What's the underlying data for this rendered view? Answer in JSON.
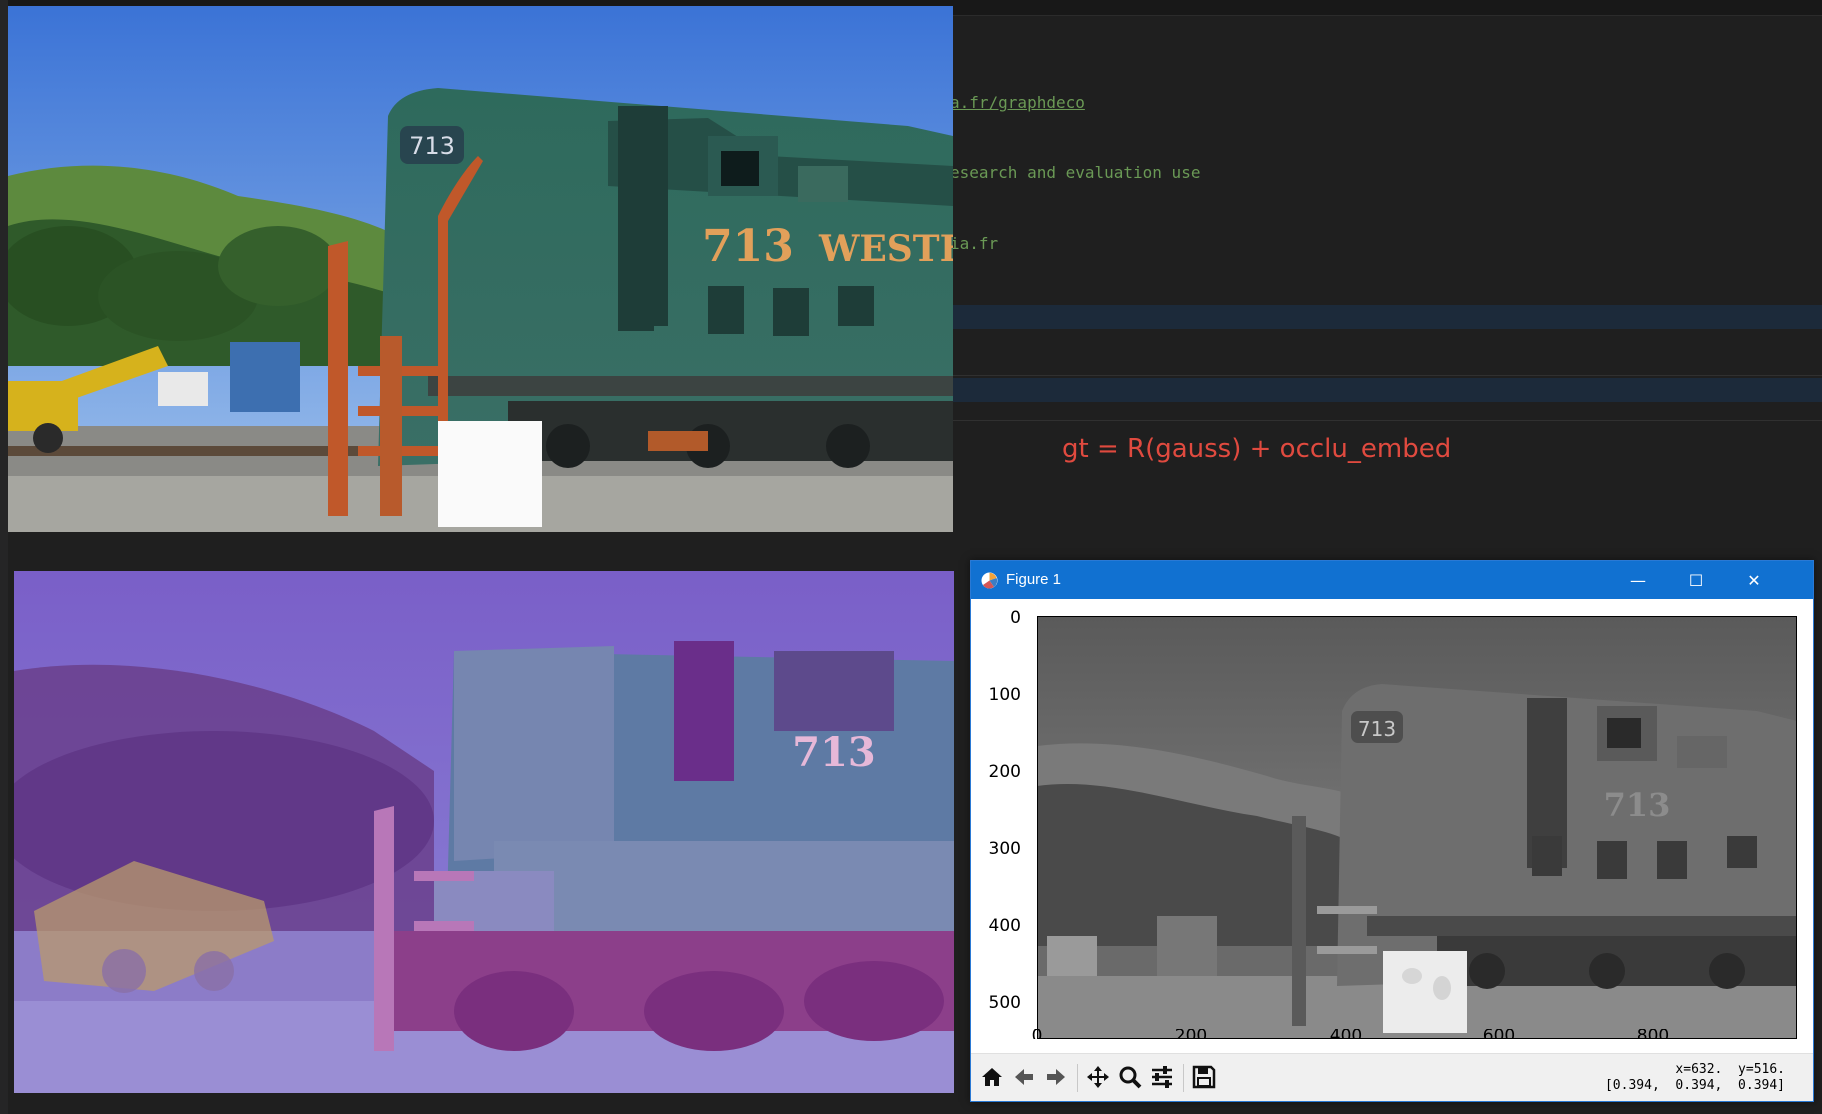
{
  "editor": {
    "lines": [
      "a.fr/graphdeco",
      "esearch and evaluation use",
      "ia.fr"
    ],
    "annotation": "gt = R(gauss) + occlu_embed"
  },
  "photos": {
    "top": {
      "train_number": "713",
      "lettering": "WESTE"
    },
    "bottom": {
      "train_number": "713"
    }
  },
  "figure": {
    "title": "Figure 1",
    "window_buttons": {
      "minimize": "—",
      "maximize": "☐",
      "close": "✕"
    },
    "yticks": [
      "0",
      "100",
      "200",
      "300",
      "400",
      "500"
    ],
    "xticks": [
      "0",
      "200",
      "400",
      "600",
      "800"
    ],
    "toolbar": {
      "tools": [
        "home-icon",
        "back-icon",
        "forward-icon",
        "pan-icon",
        "zoom-icon",
        "configure-icon",
        "save-icon"
      ]
    },
    "coords_line1": "x=632.  y=516.",
    "coords_line2": "[0.394,  0.394,  0.394]"
  },
  "colors": {
    "titlebar": "#1171d1",
    "annotation": "#e04a3f",
    "code_comment": "#6a9955"
  }
}
